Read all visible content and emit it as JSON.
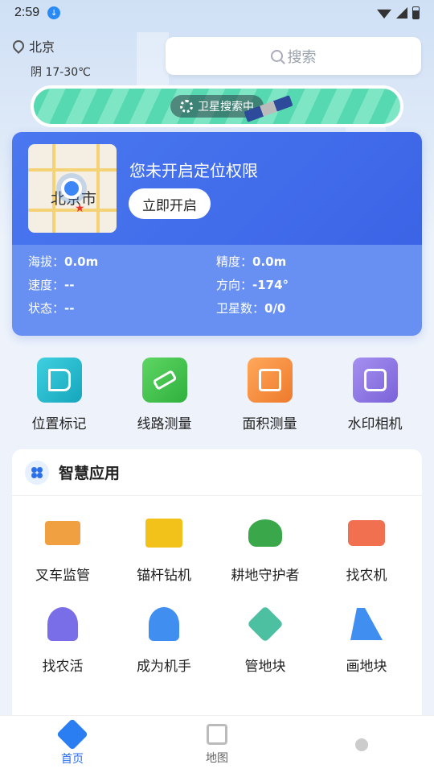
{
  "status": {
    "time": "2:59"
  },
  "location": {
    "city": "北京",
    "weather": "阴  17-30℃"
  },
  "search": {
    "placeholder": "搜索"
  },
  "satellite": {
    "label": "卫星搜索中"
  },
  "card": {
    "map_city": "北京市",
    "permission_text": "您未开启定位权限",
    "open_button": "立即开启",
    "stats": [
      {
        "label": "海拔：",
        "value": "0.0m"
      },
      {
        "label": "精度：",
        "value": "0.0m"
      },
      {
        "label": "速度：",
        "value": "--"
      },
      {
        "label": "方向：",
        "value": "-174°"
      },
      {
        "label": "状态：",
        "value": "--"
      },
      {
        "label": "卫星数：",
        "value": "0/0"
      }
    ]
  },
  "tools": [
    {
      "label": "位置标记",
      "icon": "flag-icon",
      "color": "#1fb8c9"
    },
    {
      "label": "线路测量",
      "icon": "ruler-icon",
      "color": "#3cc24a"
    },
    {
      "label": "面积测量",
      "icon": "area-icon",
      "color": "#f08a3a"
    },
    {
      "label": "水印相机",
      "icon": "camera-icon",
      "color": "#8b72e0"
    }
  ],
  "apps": {
    "title": "智慧应用",
    "items": [
      {
        "label": "叉车监管",
        "icon": "forklift-icon",
        "color": "#f0a040"
      },
      {
        "label": "锚杆钻机",
        "icon": "excavator-icon",
        "color": "#f2c21a"
      },
      {
        "label": "耕地守护者",
        "icon": "farmland-icon",
        "color": "#3aa84a"
      },
      {
        "label": "找农机",
        "icon": "tractor-icon",
        "color": "#f07050"
      },
      {
        "label": "找农活",
        "icon": "farmer-icon",
        "color": "#7a6ee8"
      },
      {
        "label": "成为机手",
        "icon": "driver-icon",
        "color": "#3f8ef0"
      },
      {
        "label": "管地块",
        "icon": "plot-icon",
        "color": "#4cc0a0"
      },
      {
        "label": "画地块",
        "icon": "draw-plot-icon",
        "color": "#3f8ef0"
      }
    ]
  },
  "nav": [
    {
      "label": "首页",
      "icon": "home-icon"
    },
    {
      "label": "地图",
      "icon": "map-icon"
    },
    {
      "label": "",
      "icon": "user-icon"
    }
  ]
}
